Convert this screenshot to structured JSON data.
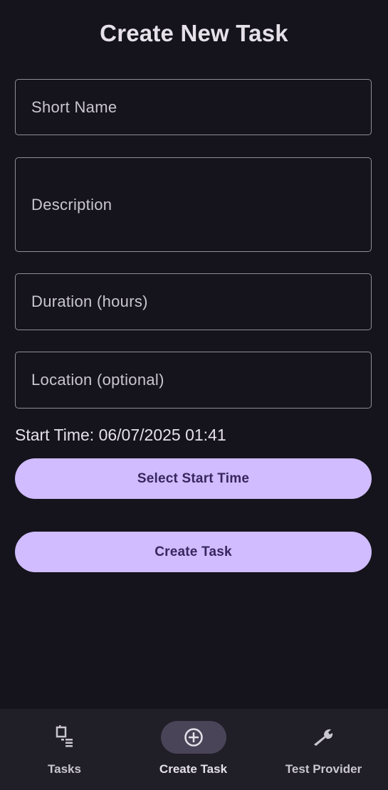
{
  "page": {
    "title": "Create New Task"
  },
  "form": {
    "short_name": {
      "placeholder": "Short Name",
      "value": ""
    },
    "description": {
      "placeholder": "Description",
      "value": ""
    },
    "duration": {
      "placeholder": "Duration (hours)",
      "value": ""
    },
    "location": {
      "placeholder": "Location (optional)",
      "value": ""
    },
    "start_time_text": "Start Time: 06/07/2025 01:41",
    "select_start_time_label": "Select Start Time",
    "create_task_label": "Create Task"
  },
  "bottom_nav": {
    "items": [
      {
        "label": "Tasks",
        "icon": "tasks-icon",
        "active": false
      },
      {
        "label": "Create Task",
        "icon": "add-circle-icon",
        "active": true
      },
      {
        "label": "Test Provider",
        "icon": "wrench-icon",
        "active": false
      }
    ]
  },
  "colors": {
    "background": "#15141c",
    "accent_button": "#d0bcff",
    "button_text": "#38265e",
    "nav_background": "#201f27",
    "active_indicator": "#4a4458",
    "field_border": "#8f8d97"
  }
}
